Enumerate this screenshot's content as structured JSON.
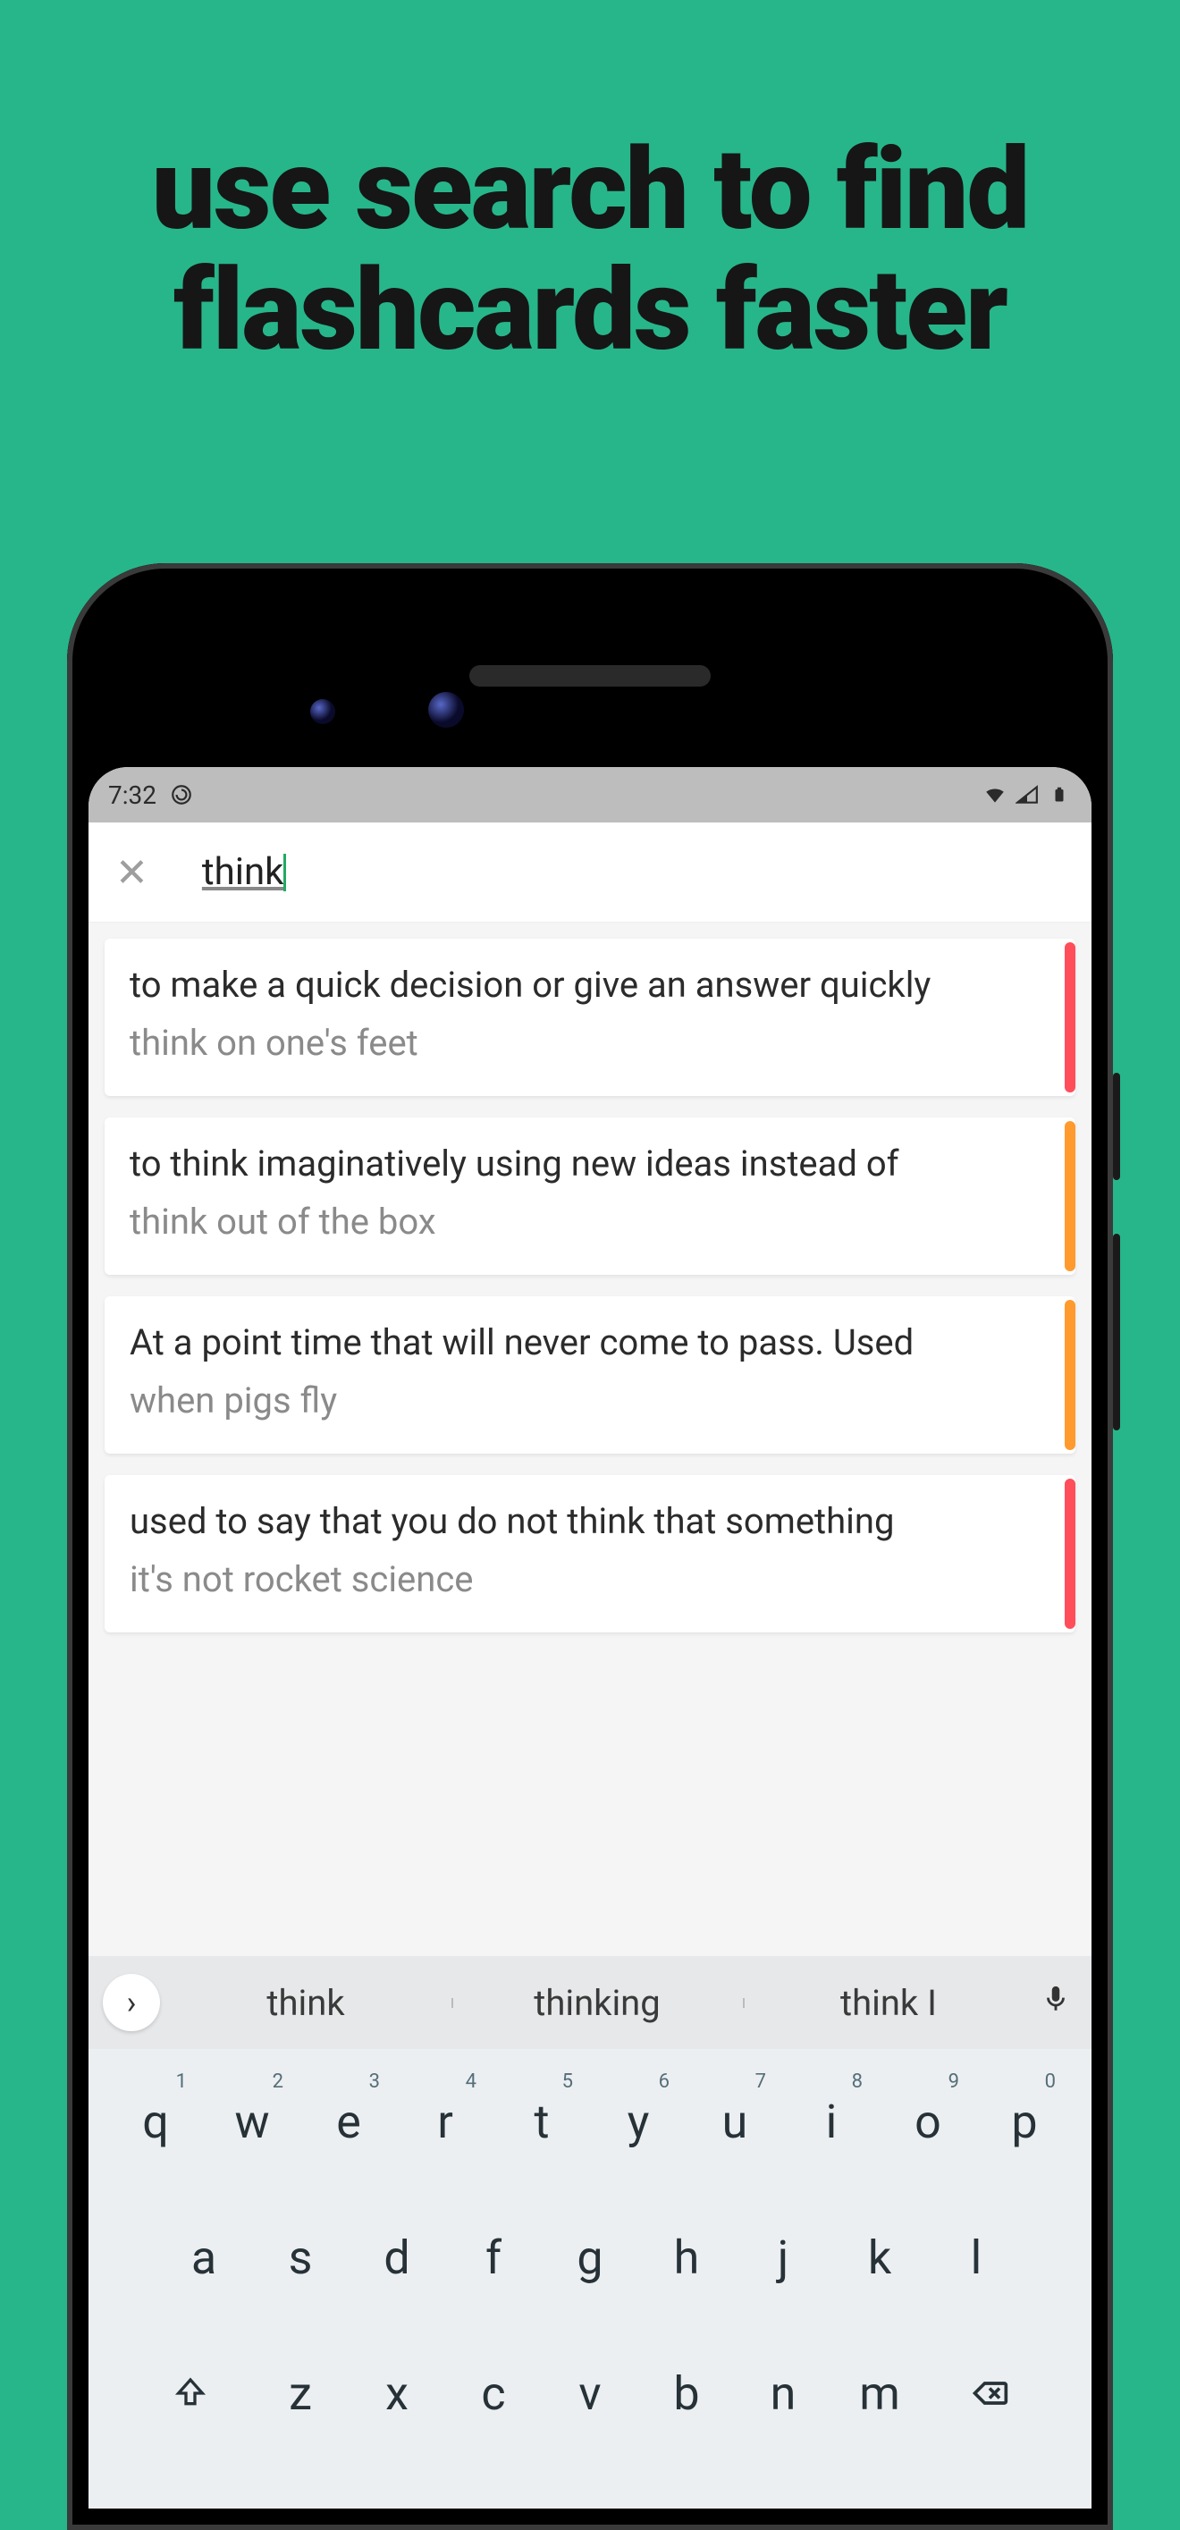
{
  "headline": "use search to find flashcards faster",
  "status": {
    "time": "7:32"
  },
  "search": {
    "value": "think"
  },
  "results": [
    {
      "title": "to make a quick decision or give an answer quickly",
      "sub": "think on one's feet",
      "stripe": "red"
    },
    {
      "title": "to think imaginatively using new ideas instead of",
      "sub": "think out of the box",
      "stripe": "orange"
    },
    {
      "title": "At a point time that will never come to pass. Used",
      "sub": "when pigs fly",
      "stripe": "orange"
    },
    {
      "title": "used to say that you do not think that something",
      "sub": "it's not rocket science",
      "stripe": "red"
    }
  ],
  "suggestions": [
    "think",
    "thinking",
    "think I"
  ],
  "keyboard": {
    "row1": [
      {
        "k": "q",
        "n": "1"
      },
      {
        "k": "w",
        "n": "2"
      },
      {
        "k": "e",
        "n": "3"
      },
      {
        "k": "r",
        "n": "4"
      },
      {
        "k": "t",
        "n": "5"
      },
      {
        "k": "y",
        "n": "6"
      },
      {
        "k": "u",
        "n": "7"
      },
      {
        "k": "i",
        "n": "8"
      },
      {
        "k": "o",
        "n": "9"
      },
      {
        "k": "p",
        "n": "0"
      }
    ],
    "row2": [
      "a",
      "s",
      "d",
      "f",
      "g",
      "h",
      "j",
      "k",
      "l"
    ],
    "row3": [
      "z",
      "x",
      "c",
      "v",
      "b",
      "n",
      "m"
    ]
  }
}
